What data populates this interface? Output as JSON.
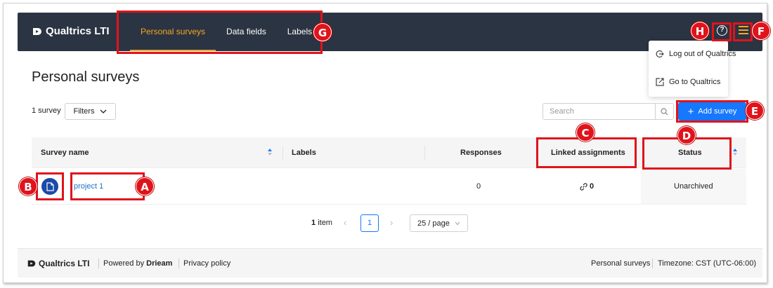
{
  "app": {
    "brand": "Qualtrics LTI",
    "help_icon": "help-circle-icon",
    "menu_icon": "hamburger-menu-icon",
    "accent": "#f5a623",
    "header_bg": "#2b3442"
  },
  "nav": {
    "tabs": [
      {
        "label": "Personal surveys",
        "active": true
      },
      {
        "label": "Data fields",
        "active": false
      },
      {
        "label": "Labels",
        "active": false
      }
    ]
  },
  "dropdown": {
    "items": [
      {
        "label": "Log out of Qualtrics",
        "icon": "logout-icon"
      },
      {
        "label": "Go to Qualtrics",
        "icon": "external-link-icon"
      }
    ]
  },
  "page": {
    "title": "Personal surveys",
    "count_label": "1 survey",
    "filters_label": "Filters",
    "search_placeholder": "Search",
    "add_button_label": "Add survey",
    "primary_color": "#1677ff"
  },
  "table": {
    "headers": {
      "name": "Survey name",
      "labels": "Labels",
      "responses": "Responses",
      "linked": "Linked assignments",
      "status": "Status"
    },
    "rows": [
      {
        "icon": "document-icon",
        "name": "project 1",
        "labels": "",
        "responses": "0",
        "linked": "0",
        "linked_icon": "link-icon",
        "status": "Unarchived"
      }
    ]
  },
  "pagination": {
    "total_number": "1",
    "total_unit": "item",
    "current_page": "1",
    "page_size": "25 / page"
  },
  "footer": {
    "brand": "Qualtrics LTI",
    "powered_prefix": "Powered by",
    "powered_name": "Drieam",
    "privacy": "Privacy policy",
    "section": "Personal surveys",
    "timezone": "Timezone: CST (UTC-06:00)"
  },
  "annotations": [
    "A",
    "B",
    "C",
    "D",
    "E",
    "F",
    "G",
    "H"
  ],
  "annotation_color": "#e0131b"
}
